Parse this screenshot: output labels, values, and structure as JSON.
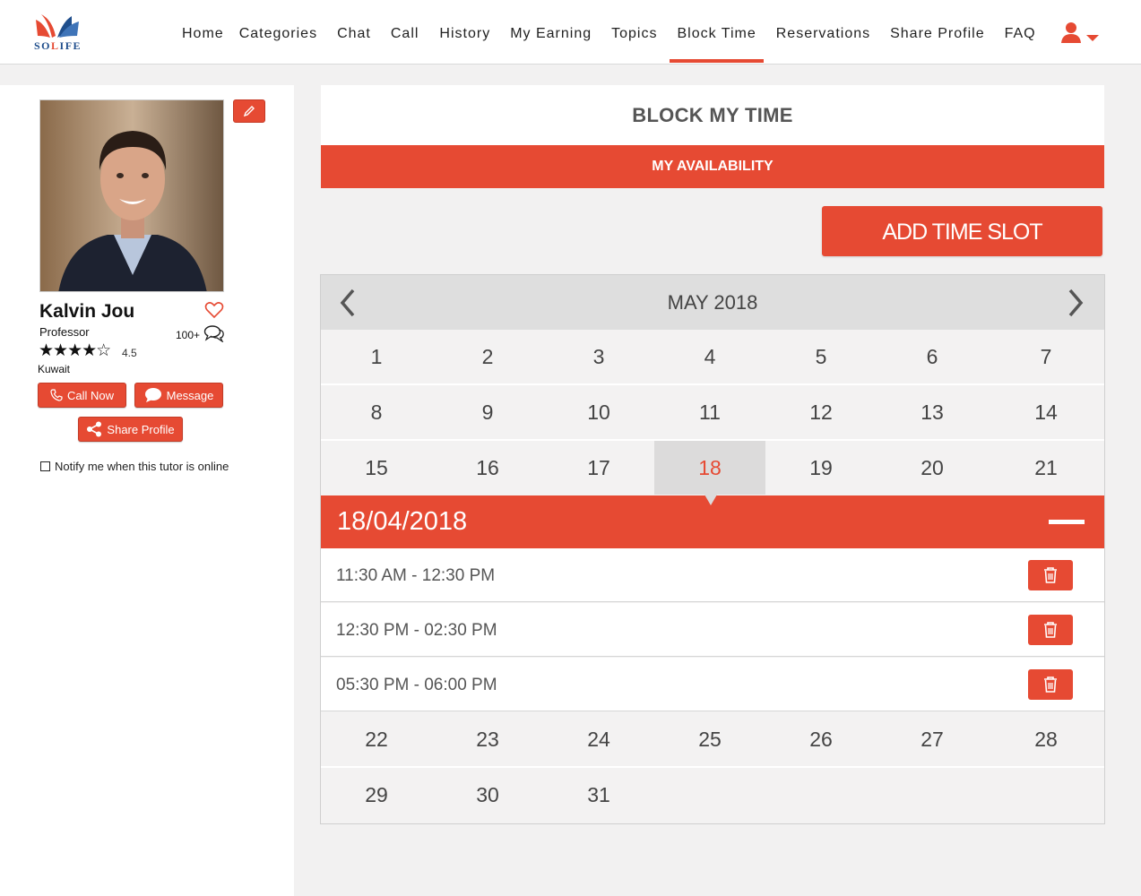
{
  "brand": {
    "logo_text_main": "SO",
    "logo_text_accent": "L",
    "logo_text_rest": "IFE",
    "accent_color": "#e64a33",
    "brand_blue": "#1f4e8c"
  },
  "nav": {
    "items": [
      {
        "label": "Home",
        "name": "home"
      },
      {
        "label": "Categories",
        "name": "categories"
      },
      {
        "label": "Chat",
        "name": "chat"
      },
      {
        "label": "Call",
        "name": "call"
      },
      {
        "label": "History",
        "name": "history"
      },
      {
        "label": "My Earning",
        "name": "my-earning"
      },
      {
        "label": "Topics",
        "name": "topics"
      },
      {
        "label": "Block Time",
        "name": "block-time",
        "active": true
      },
      {
        "label": "Reservations",
        "name": "reservations"
      },
      {
        "label": "Share Profile",
        "name": "share-profile"
      },
      {
        "label": "FAQ",
        "name": "faq"
      }
    ],
    "user_icon": "user-icon"
  },
  "profile": {
    "name": "Kalvin Jou",
    "title": "Professor",
    "review_count": "100+",
    "stars": "★★★★☆",
    "rating": "4.5",
    "location": "Kuwait",
    "call_label": "Call Now",
    "message_label": "Message",
    "share_label": "Share Profile",
    "notify_label": "Notify me when this tutor is online"
  },
  "main": {
    "title": "BLOCK MY TIME",
    "tab_label": "MY AVAILABILITY",
    "add_slot_label": "ADD TIME SLOT"
  },
  "calendar": {
    "month_label": "MAY 2018",
    "weeks": [
      [
        "1",
        "2",
        "3",
        "4",
        "5",
        "6",
        "7"
      ],
      [
        "8",
        "9",
        "10",
        "11",
        "12",
        "13",
        "14"
      ],
      [
        "15",
        "16",
        "17",
        "18",
        "19",
        "20",
        "21"
      ],
      [
        "22",
        "23",
        "24",
        "25",
        "26",
        "27",
        "28"
      ],
      [
        "29",
        "30",
        "31",
        "",
        "",
        "",
        ""
      ]
    ],
    "selected_day": "18",
    "selected_date": "18/04/2018",
    "slots": [
      {
        "time": "11:30 AM - 12:30 PM"
      },
      {
        "time": "12:30 PM - 02:30 PM"
      },
      {
        "time": "05:30 PM - 06:00 PM"
      }
    ]
  }
}
